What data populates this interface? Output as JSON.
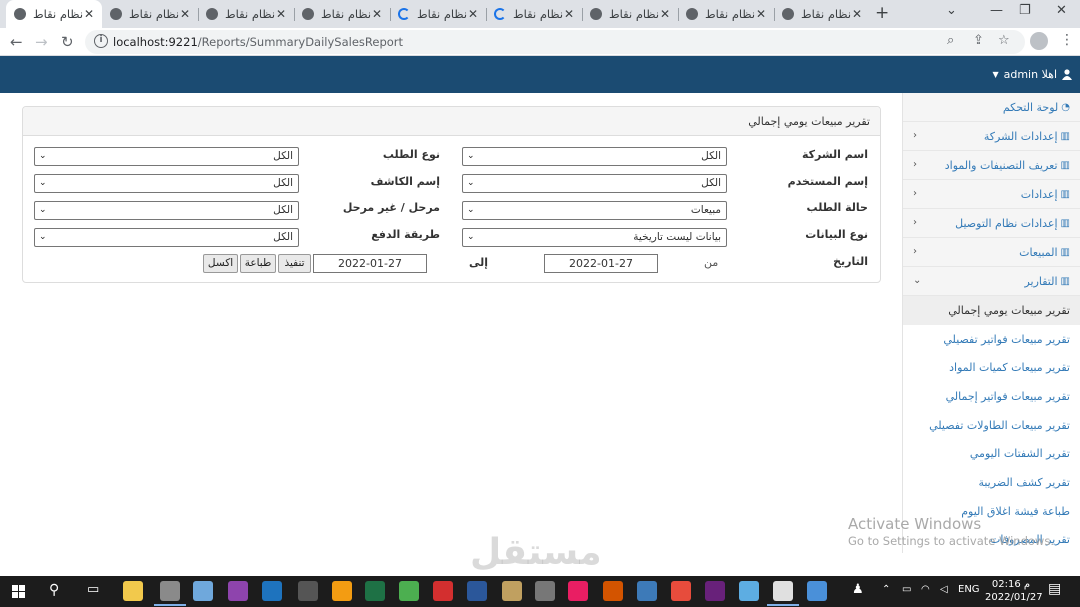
{
  "browser": {
    "tabs": [
      {
        "title": "نظام نقاط",
        "active": true
      },
      {
        "title": "نظام نقاط"
      },
      {
        "title": "نظام نقاط"
      },
      {
        "title": "نظام نقاط"
      },
      {
        "title": "نظام نقاط",
        "loading": true
      },
      {
        "title": "نظام نقاط",
        "loading": true
      },
      {
        "title": "نظام نقاط"
      },
      {
        "title": "نظام نقاط"
      },
      {
        "title": "نظام نقاط"
      }
    ],
    "new_tab": "+",
    "url_host": "localhost:9221",
    "url_path": "/Reports/SummaryDailySalesReport"
  },
  "header": {
    "user_label": "admin اهلا"
  },
  "sidebar": {
    "items": [
      {
        "label": "لوحة التحكم",
        "icon": "dashboard-icon"
      },
      {
        "label": "إعدادات الشركة",
        "icon": "chart-icon",
        "expandable": true
      },
      {
        "label": "تعريف التصنيفات والمواد",
        "icon": "chart-icon",
        "expandable": true
      },
      {
        "label": "إعدادات",
        "icon": "chart-icon",
        "expandable": true
      },
      {
        "label": "إعدادات نظام التوصيل",
        "icon": "chart-icon",
        "expandable": true
      },
      {
        "label": "المبيعات",
        "icon": "chart-icon",
        "expandable": true
      },
      {
        "label": "التقارير",
        "icon": "chart-icon",
        "expanded": true
      }
    ],
    "sub_items": [
      {
        "label": "تقرير مبيعات يومي إجمالي",
        "active": true
      },
      {
        "label": "تقرير مبيعات فواتير تفصيلي"
      },
      {
        "label": "تقرير مبيعات كميات المواد"
      },
      {
        "label": "تقرير مبيعات فواتير إجمالي"
      },
      {
        "label": "تقرير مبيعات الطاولات تفصيلي"
      },
      {
        "label": "تقرير الشفتات اليومي"
      },
      {
        "label": "تقرير كشف الضريبة"
      },
      {
        "label": "طباعة فيشة اغلاق اليوم"
      },
      {
        "label": "تقرير المصروفات"
      }
    ]
  },
  "report": {
    "title": "تقرير مبيعات يومي إجمالي",
    "labels": {
      "company": "اسم الشركة",
      "order_type": "نوع الطلب",
      "user": "إسم المستخدم",
      "cashier": "إسم الكاشف",
      "order_status": "حالة الطلب",
      "staged": "مرحل / غير مرحل",
      "data_type": "نوع البيانات",
      "payment": "طريقة الدفع",
      "date": "التاريخ",
      "from": "من",
      "to": "إلى"
    },
    "values": {
      "company": "الكل",
      "order_type": "الكل",
      "user": "الكل",
      "cashier": "الكل",
      "order_status": "مبيعات",
      "staged": "الكل",
      "data_type": "بيانات ليست تاريخية",
      "payment": "الكل",
      "date_from": "2022-01-27",
      "date_to": "2022-01-27"
    },
    "buttons": {
      "execute": "تنفيذ",
      "print": "طباعة",
      "excel": "اكسل"
    }
  },
  "watermark": {
    "line1": "Activate Windows",
    "line2": "Go to Settings to activate Windows.",
    "logo": "مستقل"
  },
  "taskbar": {
    "language": "ENG",
    "time": "02:16 م",
    "date": "2022/01/27"
  }
}
